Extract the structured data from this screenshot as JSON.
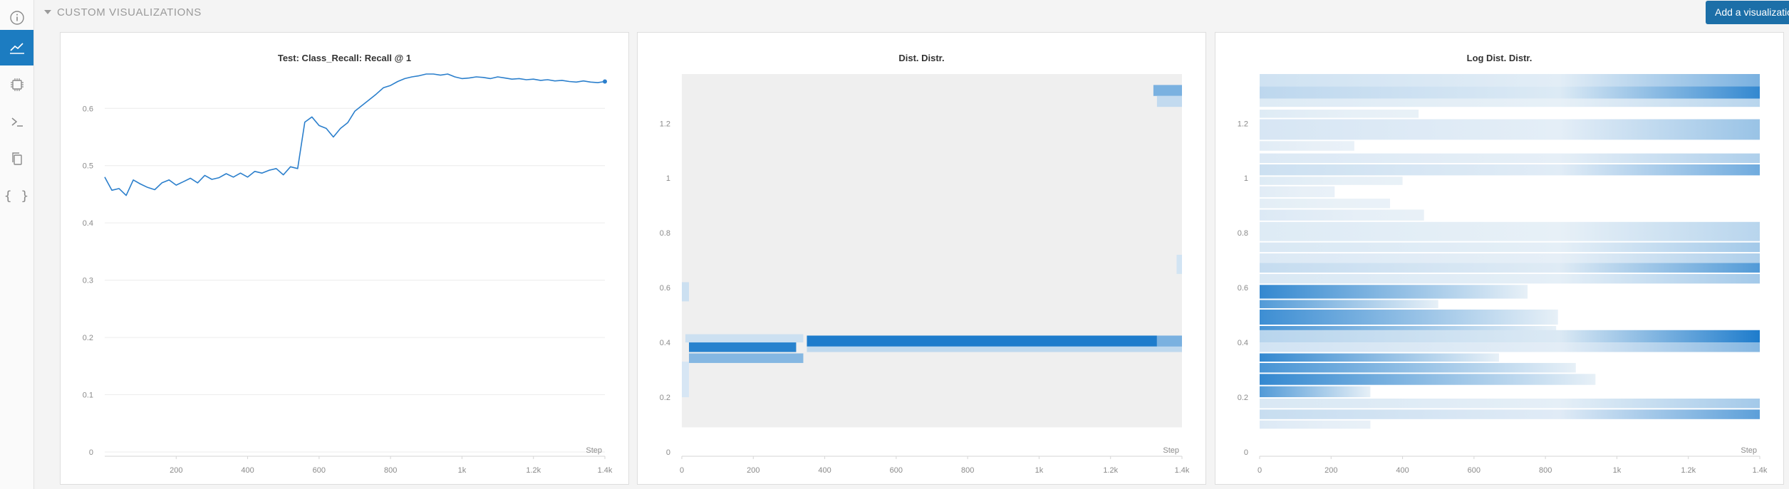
{
  "section": {
    "title": "CUSTOM VISUALIZATIONS"
  },
  "toolbar": {
    "add_label": "Add a visualization"
  },
  "sidebar": {
    "items": [
      {
        "icon": "info-icon",
        "active": false
      },
      {
        "icon": "line-chart-icon",
        "active": true
      },
      {
        "icon": "chip-icon",
        "active": false
      },
      {
        "icon": "terminal-icon",
        "active": false
      },
      {
        "icon": "files-icon",
        "active": false
      },
      {
        "icon": "braces-icon",
        "active": false,
        "glyph": "{ }"
      }
    ]
  },
  "colors": {
    "accent": "#1c7cc1",
    "button": "#1c6fa8",
    "line": "#2b7fcc",
    "heat_empty": "#efefef"
  },
  "chart_data": [
    {
      "type": "line",
      "title": "Test: Class_Recall: Recall @ 1",
      "xlabel": "Step",
      "ylabel": "",
      "xlim": [
        0,
        1400
      ],
      "ylim": [
        0,
        0.66
      ],
      "x_ticks": [
        200,
        400,
        600,
        800,
        1000,
        1200,
        1400
      ],
      "x_tick_labels": [
        "200",
        "400",
        "600",
        "800",
        "1k",
        "1.2k",
        "1.4k"
      ],
      "y_ticks": [
        0,
        0.1,
        0.2,
        0.3,
        0.4,
        0.5,
        0.6
      ],
      "y_tick_labels": [
        "0",
        "0.1",
        "0.2",
        "0.3",
        "0.4",
        "0.5",
        "0.6"
      ],
      "grid": true,
      "series": [
        {
          "x": [
            0,
            20,
            40,
            60,
            80,
            100,
            120,
            140,
            160,
            180,
            200,
            220,
            240,
            260,
            280,
            300,
            320,
            340,
            360,
            380,
            400,
            420,
            440,
            460,
            480,
            500,
            520,
            540,
            560,
            580,
            600,
            620,
            640,
            660,
            680,
            700,
            720,
            740,
            760,
            780,
            800,
            820,
            840,
            860,
            880,
            900,
            920,
            940,
            960,
            980,
            1000,
            1020,
            1040,
            1060,
            1080,
            1100,
            1120,
            1140,
            1160,
            1180,
            1200,
            1220,
            1240,
            1260,
            1280,
            1300,
            1320,
            1340,
            1360,
            1380,
            1400
          ],
          "values": [
            0.48,
            0.457,
            0.46,
            0.448,
            0.475,
            0.468,
            0.462,
            0.458,
            0.47,
            0.475,
            0.466,
            0.472,
            0.478,
            0.47,
            0.483,
            0.476,
            0.479,
            0.486,
            0.48,
            0.487,
            0.48,
            0.49,
            0.487,
            0.492,
            0.495,
            0.484,
            0.498,
            0.495,
            0.576,
            0.585,
            0.57,
            0.565,
            0.55,
            0.565,
            0.575,
            0.595,
            0.605,
            0.615,
            0.625,
            0.636,
            0.64,
            0.647,
            0.652,
            0.655,
            0.657,
            0.66,
            0.66,
            0.658,
            0.66,
            0.655,
            0.652,
            0.653,
            0.655,
            0.654,
            0.652,
            0.655,
            0.653,
            0.651,
            0.652,
            0.65,
            0.651,
            0.649,
            0.65,
            0.648,
            0.649,
            0.647,
            0.646,
            0.648,
            0.646,
            0.645,
            0.647
          ]
        }
      ]
    },
    {
      "type": "heatmap",
      "title": "Dist. Distr.",
      "xlabel": "Step",
      "xlim": [
        0,
        1400
      ],
      "ylim": [
        0,
        1.38
      ],
      "x_ticks": [
        0,
        200,
        400,
        600,
        800,
        1000,
        1200,
        1400
      ],
      "x_tick_labels": [
        "0",
        "200",
        "400",
        "600",
        "800",
        "1k",
        "1.2k",
        "1.4k"
      ],
      "y_ticks": [
        0,
        0.2,
        0.4,
        0.6,
        0.8,
        1.0,
        1.2
      ],
      "y_tick_labels": [
        "0",
        "0.2",
        "0.4",
        "0.6",
        "0.8",
        "1",
        "1.2"
      ],
      "y_range": [
        0.09,
        1.38
      ],
      "bands": [
        {
          "y0": 0.385,
          "y1": 0.425,
          "x0": 350,
          "x1": 1330,
          "intensity": 1.0
        },
        {
          "y0": 0.365,
          "y1": 0.385,
          "x0": 350,
          "x1": 1400,
          "intensity": 0.22
        },
        {
          "y0": 0.385,
          "y1": 0.425,
          "x0": 1330,
          "x1": 1400,
          "intensity": 0.55
        },
        {
          "y0": 0.365,
          "y1": 0.405,
          "x0": 20,
          "x1": 320,
          "intensity": 0.95
        },
        {
          "y0": 0.325,
          "y1": 0.36,
          "x0": 20,
          "x1": 340,
          "intensity": 0.5
        },
        {
          "y0": 0.4,
          "y1": 0.43,
          "x0": 10,
          "x1": 340,
          "intensity": 0.15
        },
        {
          "y0": 1.3,
          "y1": 1.34,
          "x0": 1320,
          "x1": 1400,
          "intensity": 0.55
        },
        {
          "y0": 1.26,
          "y1": 1.3,
          "x0": 1330,
          "x1": 1400,
          "intensity": 0.2
        },
        {
          "y0": 0.55,
          "y1": 0.62,
          "x0": 0,
          "x1": 20,
          "intensity": 0.15
        },
        {
          "y0": 0.2,
          "y1": 0.33,
          "x0": 0,
          "x1": 20,
          "intensity": 0.1
        },
        {
          "y0": 0.65,
          "y1": 0.72,
          "x0": 1385,
          "x1": 1400,
          "intensity": 0.12
        }
      ]
    },
    {
      "type": "heatmap",
      "title": "Log Dist. Distr.",
      "xlabel": "Step",
      "xlim": [
        0,
        1400
      ],
      "ylim": [
        0,
        1.38
      ],
      "x_ticks": [
        0,
        200,
        400,
        600,
        800,
        1000,
        1200,
        1400
      ],
      "x_tick_labels": [
        "0",
        "200",
        "400",
        "600",
        "800",
        "1k",
        "1.2k",
        "1.4k"
      ],
      "y_ticks": [
        0,
        0.2,
        0.4,
        0.6,
        0.8,
        1.0,
        1.2
      ],
      "y_tick_labels": [
        "0",
        "0.2",
        "0.4",
        "0.6",
        "0.8",
        "1",
        "1.2"
      ],
      "y_range": [
        0.09,
        1.38
      ],
      "bands": [
        {
          "y0": 1.335,
          "y1": 1.38,
          "x0": 0,
          "x1": 1400,
          "intensity": 0.55
        },
        {
          "y0": 1.29,
          "y1": 1.335,
          "x0": 0,
          "x1": 1400,
          "intensity": 0.9
        },
        {
          "y0": 1.26,
          "y1": 1.29,
          "x0": 0,
          "x1": 1400,
          "intensity": 0.25
        },
        {
          "y0": 1.22,
          "y1": 1.25,
          "x0": 0,
          "x1": 445,
          "intensity": 0.25
        },
        {
          "y0": 1.14,
          "y1": 1.215,
          "x0": 0,
          "x1": 1400,
          "intensity": 0.4
        },
        {
          "y0": 1.1,
          "y1": 1.135,
          "x0": 0,
          "x1": 265,
          "intensity": 0.2
        },
        {
          "y0": 1.055,
          "y1": 1.09,
          "x0": 0,
          "x1": 1400,
          "intensity": 0.3
        },
        {
          "y0": 1.01,
          "y1": 1.05,
          "x0": 0,
          "x1": 1400,
          "intensity": 0.6
        },
        {
          "y0": 0.975,
          "y1": 1.005,
          "x0": 0,
          "x1": 400,
          "intensity": 0.25
        },
        {
          "y0": 0.93,
          "y1": 0.97,
          "x0": 0,
          "x1": 210,
          "intensity": 0.2
        },
        {
          "y0": 0.89,
          "y1": 0.925,
          "x0": 0,
          "x1": 365,
          "intensity": 0.15
        },
        {
          "y0": 0.845,
          "y1": 0.885,
          "x0": 0,
          "x1": 460,
          "intensity": 0.3
        },
        {
          "y0": 0.77,
          "y1": 0.84,
          "x0": 0,
          "x1": 1400,
          "intensity": 0.25
        },
        {
          "y0": 0.73,
          "y1": 0.765,
          "x0": 0,
          "x1": 1400,
          "intensity": 0.35
        },
        {
          "y0": 0.69,
          "y1": 0.725,
          "x0": 0,
          "x1": 1400,
          "intensity": 0.3
        },
        {
          "y0": 0.655,
          "y1": 0.69,
          "x0": 0,
          "x1": 1400,
          "intensity": 0.75
        },
        {
          "y0": 0.615,
          "y1": 0.65,
          "x0": 0,
          "x1": 1400,
          "intensity": 0.35
        },
        {
          "y0": 0.56,
          "y1": 0.61,
          "x0": 0,
          "x1": 750,
          "intensity": 0.9
        },
        {
          "y0": 0.525,
          "y1": 0.555,
          "x0": 0,
          "x1": 500,
          "intensity": 0.75
        },
        {
          "y0": 0.465,
          "y1": 0.52,
          "x0": 0,
          "x1": 835,
          "intensity": 0.85
        },
        {
          "y0": 0.43,
          "y1": 0.46,
          "x0": 0,
          "x1": 830,
          "intensity": 0.8
        },
        {
          "y0": 0.4,
          "y1": 0.445,
          "x0": 0,
          "x1": 1400,
          "intensity": 1.0
        },
        {
          "y0": 0.365,
          "y1": 0.4,
          "x0": 0,
          "x1": 1400,
          "intensity": 0.5
        },
        {
          "y0": 0.33,
          "y1": 0.36,
          "x0": 0,
          "x1": 670,
          "intensity": 0.9
        },
        {
          "y0": 0.29,
          "y1": 0.325,
          "x0": 0,
          "x1": 885,
          "intensity": 0.8
        },
        {
          "y0": 0.245,
          "y1": 0.285,
          "x0": 0,
          "x1": 940,
          "intensity": 0.9
        },
        {
          "y0": 0.2,
          "y1": 0.24,
          "x0": 0,
          "x1": 310,
          "intensity": 0.75
        },
        {
          "y0": 0.16,
          "y1": 0.195,
          "x0": 0,
          "x1": 1400,
          "intensity": 0.35
        },
        {
          "y0": 0.12,
          "y1": 0.155,
          "x0": 0,
          "x1": 1400,
          "intensity": 0.7
        },
        {
          "y0": 0.085,
          "y1": 0.115,
          "x0": 0,
          "x1": 310,
          "intensity": 0.3
        }
      ]
    }
  ]
}
